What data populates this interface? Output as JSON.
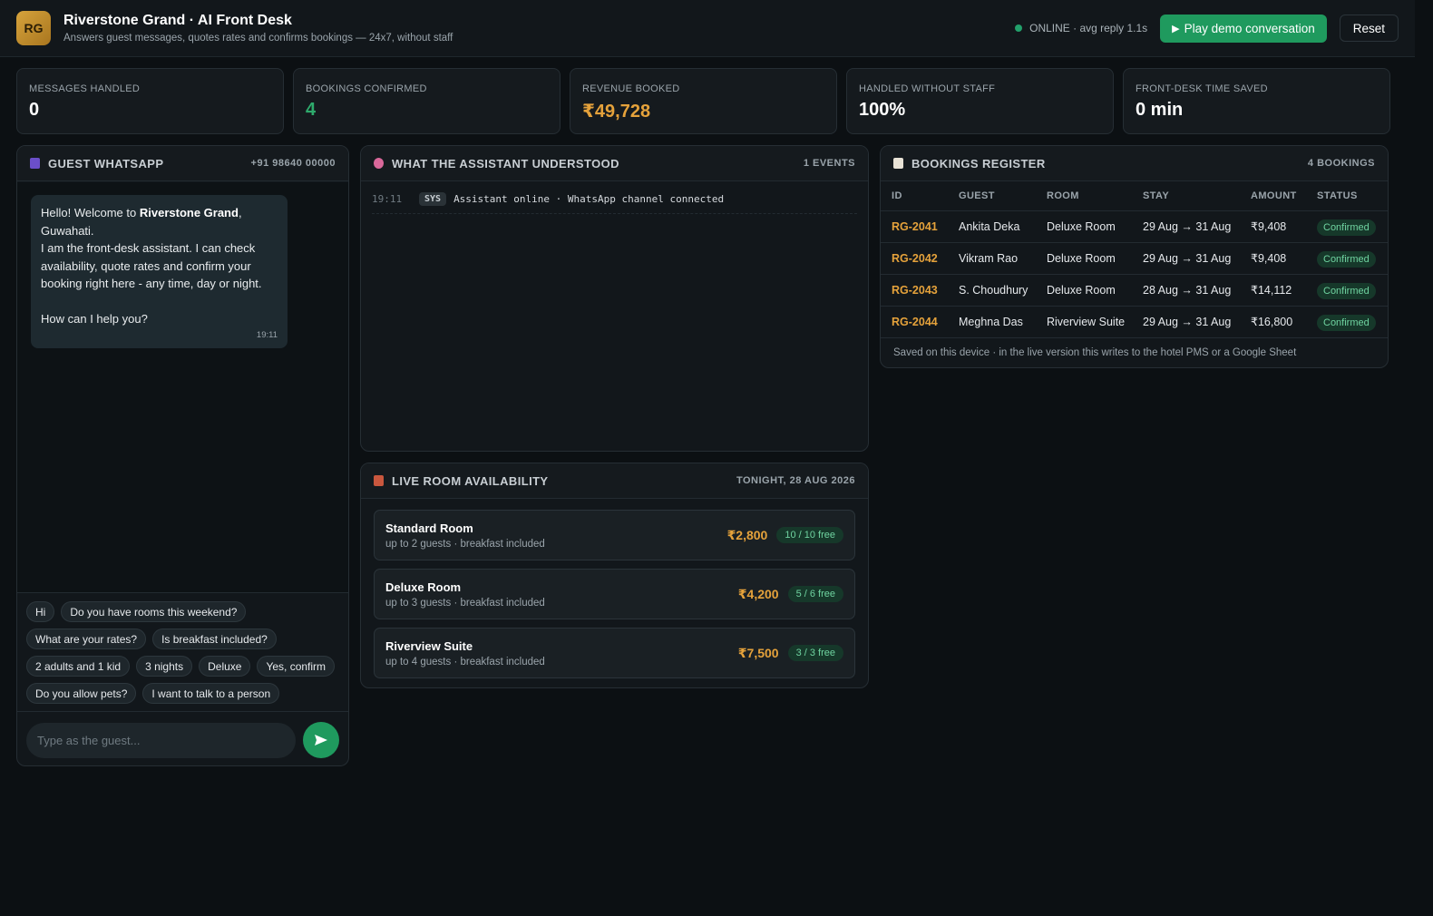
{
  "header": {
    "logo_text": "RG",
    "title": "Riverstone Grand · AI Front Desk",
    "subtitle": "Answers guest messages, quotes rates and confirms bookings — 24x7, without staff",
    "status": "ONLINE · avg reply 1.1s",
    "demo_button": "Play demo conversation",
    "reset_button": "Reset"
  },
  "stats": [
    {
      "label": "MESSAGES HANDLED",
      "value": "0"
    },
    {
      "label": "BOOKINGS CONFIRMED",
      "value": "4"
    },
    {
      "label": "REVENUE BOOKED",
      "value": "₹49,728"
    },
    {
      "label": "HANDLED WITHOUT STAFF",
      "value": "100%"
    },
    {
      "label": "FRONT-DESK TIME SAVED",
      "value": "0 min"
    }
  ],
  "whatsapp": {
    "title": "GUEST WHATSAPP",
    "phone": "+91 98640 00000",
    "message": {
      "greeting": "Hello! Welcome to ",
      "hotel": "Riverstone Grand",
      "city": ", Guwahati.",
      "line2": "I am the front-desk assistant. I can check availability, quote rates and confirm your booking right here - any time, day or night.",
      "line3": "How can I help you?",
      "time": "19:11"
    },
    "quick_replies": [
      [
        "Hi",
        "Do you have rooms this weekend?"
      ],
      [
        "What are your rates?",
        "Is breakfast included?"
      ],
      [
        "2 adults and 1 kid",
        "3 nights",
        "Deluxe",
        "Yes, confirm"
      ],
      [
        "Do you allow pets?",
        "I want to talk to a person"
      ]
    ],
    "input_placeholder": "Type as the guest..."
  },
  "understood": {
    "title": "WHAT THE ASSISTANT UNDERSTOOD",
    "count": "1 EVENTS",
    "events": [
      {
        "time": "19:11",
        "tag": "SYS",
        "text": "Assistant online · WhatsApp channel connected"
      }
    ]
  },
  "availability": {
    "title": "LIVE ROOM AVAILABILITY",
    "date": "TONIGHT, 28 AUG 2026",
    "rooms": [
      {
        "name": "Standard Room",
        "desc": "up to 2 guests · breakfast included",
        "price": "₹2,800",
        "free": "10 / 10 free"
      },
      {
        "name": "Deluxe Room",
        "desc": "up to 3 guests · breakfast included",
        "price": "₹4,200",
        "free": "5 / 6 free"
      },
      {
        "name": "Riverview Suite",
        "desc": "up to 4 guests · breakfast included",
        "price": "₹7,500",
        "free": "3 / 3 free"
      }
    ]
  },
  "bookings": {
    "title": "BOOKINGS REGISTER",
    "count": "4 BOOKINGS",
    "columns": [
      "ID",
      "GUEST",
      "ROOM",
      "STAY",
      "AMOUNT",
      "STATUS"
    ],
    "rows": [
      {
        "id": "RG-2041",
        "guest": "Ankita Deka",
        "room": "Deluxe Room",
        "stay": "29 Aug → 31 Aug",
        "amount": "₹9,408",
        "status": "Confirmed"
      },
      {
        "id": "RG-2042",
        "guest": "Vikram Rao",
        "room": "Deluxe Room",
        "stay": "29 Aug → 31 Aug",
        "amount": "₹9,408",
        "status": "Confirmed"
      },
      {
        "id": "RG-2043",
        "guest": "S. Choudhury",
        "room": "Deluxe Room",
        "stay": "28 Aug → 31 Aug",
        "amount": "₹14,112",
        "status": "Confirmed"
      },
      {
        "id": "RG-2044",
        "guest": "Meghna Das",
        "room": "Riverview Suite",
        "stay": "29 Aug → 31 Aug",
        "amount": "₹16,800",
        "status": "Confirmed"
      }
    ],
    "footer": "Saved on this device · in the live version this writes to the hotel PMS or a Google Sheet"
  },
  "colors": {
    "accent_green": "#1f9a5e",
    "accent_gold": "#e5a23b",
    "background": "#0c1013"
  }
}
